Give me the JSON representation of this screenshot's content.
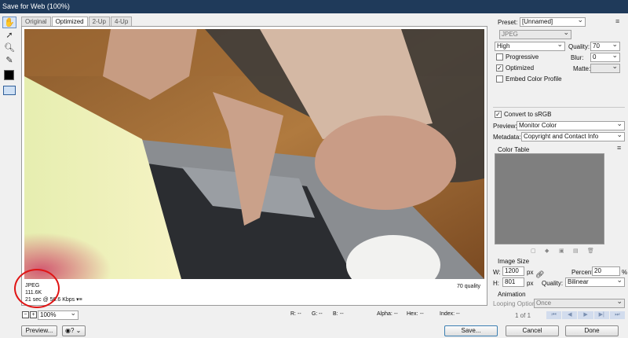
{
  "window": {
    "title": "Save for Web (100%)"
  },
  "tabs": [
    "Original",
    "Optimized",
    "2-Up",
    "4-Up"
  ],
  "active_tab": "Optimized",
  "image_info": {
    "format": "JPEG",
    "size": "111.6K",
    "download_time": "21 sec @ 56.6 Kbps",
    "quality_text": "70 quality"
  },
  "statusbar": {
    "zoom": "100%",
    "r_label": "R:",
    "r_value": "--",
    "g_label": "G:",
    "g_value": "--",
    "b_label": "B:",
    "b_value": "--",
    "alpha_label": "Alpha:",
    "alpha_value": "--",
    "hex_label": "Hex:",
    "hex_value": "--",
    "index_label": "Index:",
    "index_value": "--"
  },
  "buttons": {
    "preview": "Preview...",
    "save": "Save...",
    "cancel": "Cancel",
    "done": "Done"
  },
  "settings": {
    "preset_label": "Preset:",
    "preset_value": "[Unnamed]",
    "format": "JPEG",
    "compression": "High",
    "quality_label": "Quality:",
    "quality_value": "70",
    "blur_label": "Blur:",
    "blur_value": "0",
    "matte_label": "Matte:",
    "progressive_label": "Progressive",
    "progressive_checked": false,
    "optimized_label": "Optimized",
    "optimized_checked": true,
    "embed_label": "Embed Color Profile",
    "embed_checked": false,
    "convert_label": "Convert to sRGB",
    "convert_checked": true,
    "preview_label": "Preview:",
    "preview_value": "Monitor Color",
    "metadata_label": "Metadata:",
    "metadata_value": "Copyright and Contact Info"
  },
  "color_table": {
    "title": "Color Table"
  },
  "image_size": {
    "title": "Image Size",
    "w_label": "W:",
    "w_value": "1200",
    "h_label": "H:",
    "h_value": "801",
    "unit": "px",
    "percent_label": "Percent:",
    "percent_value": "20",
    "percent_unit": "%",
    "quality_label": "Quality:",
    "quality_value": "Bilinear"
  },
  "animation": {
    "title": "Animation",
    "looping_label": "Looping Options:",
    "looping_value": "Once",
    "frame_counter": "1 of 1"
  },
  "colors": {
    "titlebar": "#1f3a5a",
    "highlight": "#e01515"
  }
}
